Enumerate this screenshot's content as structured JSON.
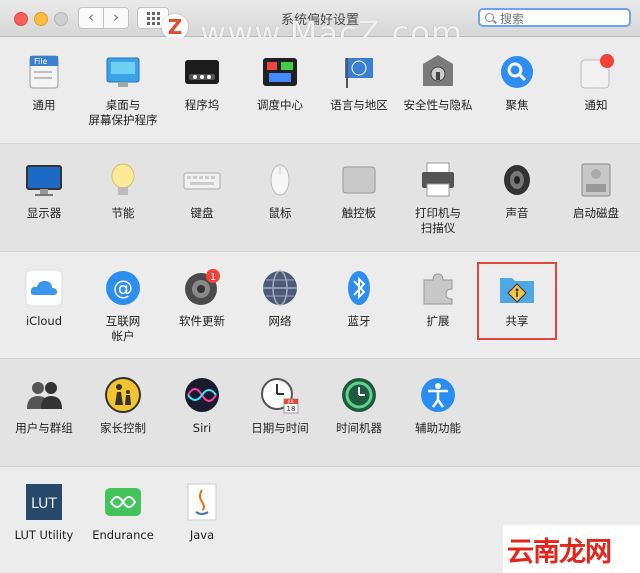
{
  "window": {
    "title": "系统偏好设置",
    "search_placeholder": "搜索"
  },
  "watermark": {
    "logo_letter": "Z",
    "text": "www.MacZ.com",
    "corner_text": "云南龙网"
  },
  "rows": [
    [
      {
        "label": "通用",
        "icon": "general-icon"
      },
      {
        "label": "桌面与\n屏幕保护程序",
        "icon": "desktop-screensaver-icon"
      },
      {
        "label": "程序坞",
        "icon": "dock-icon"
      },
      {
        "label": "调度中心",
        "icon": "mission-control-icon"
      },
      {
        "label": "语言与地区",
        "icon": "language-region-icon"
      },
      {
        "label": "安全性与隐私",
        "icon": "security-privacy-icon"
      },
      {
        "label": "聚焦",
        "icon": "spotlight-icon"
      },
      {
        "label": "通知",
        "icon": "notifications-icon"
      }
    ],
    [
      {
        "label": "显示器",
        "icon": "displays-icon"
      },
      {
        "label": "节能",
        "icon": "energy-saver-icon"
      },
      {
        "label": "键盘",
        "icon": "keyboard-icon"
      },
      {
        "label": "鼠标",
        "icon": "mouse-icon"
      },
      {
        "label": "触控板",
        "icon": "trackpad-icon"
      },
      {
        "label": "打印机与\n扫描仪",
        "icon": "printers-scanners-icon"
      },
      {
        "label": "声音",
        "icon": "sound-icon"
      },
      {
        "label": "启动磁盘",
        "icon": "startup-disk-icon"
      }
    ],
    [
      {
        "label": "iCloud",
        "icon": "icloud-icon"
      },
      {
        "label": "互联网\n帐户",
        "icon": "internet-accounts-icon"
      },
      {
        "label": "软件更新",
        "icon": "software-update-icon",
        "badge": "1"
      },
      {
        "label": "网络",
        "icon": "network-icon"
      },
      {
        "label": "蓝牙",
        "icon": "bluetooth-icon"
      },
      {
        "label": "扩展",
        "icon": "extensions-icon"
      },
      {
        "label": "共享",
        "icon": "sharing-icon"
      }
    ],
    [
      {
        "label": "用户与群组",
        "icon": "users-groups-icon"
      },
      {
        "label": "家长控制",
        "icon": "parental-controls-icon"
      },
      {
        "label": "Siri",
        "icon": "siri-icon"
      },
      {
        "label": "日期与时间",
        "icon": "date-time-icon",
        "calendar_day": "18",
        "calendar_month": "JUL"
      },
      {
        "label": "时间机器",
        "icon": "time-machine-icon"
      },
      {
        "label": "辅助功能",
        "icon": "accessibility-icon"
      }
    ],
    [
      {
        "label": "LUT Utility",
        "icon": "lut-utility-icon",
        "icon_text": "LUT"
      },
      {
        "label": "Endurance",
        "icon": "endurance-icon"
      },
      {
        "label": "Java",
        "icon": "java-icon"
      }
    ]
  ],
  "colors": {
    "highlight": "#e0473c",
    "accent": "#6ea3ef"
  }
}
